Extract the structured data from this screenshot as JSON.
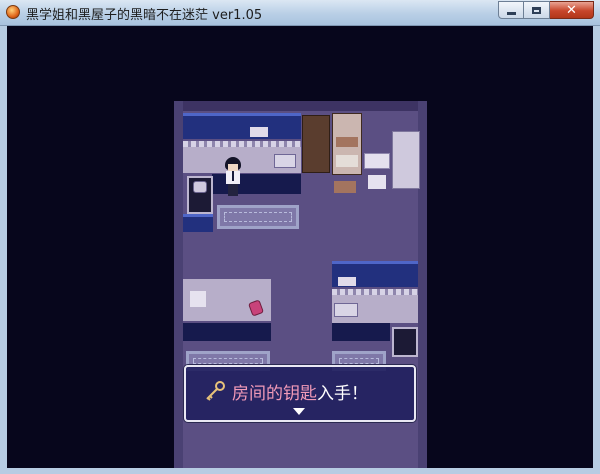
{
  "window": {
    "title": "黑学姐和黑屋子的黑暗不在迷茫 ver1.05",
    "buttons": [
      "minimize",
      "maximize",
      "close"
    ]
  },
  "dialog": {
    "item_name": "房间的钥匙",
    "suffix": "入手！",
    "icon": "key-icon",
    "continue_icon": "down-arrow-icon"
  },
  "colors": {
    "background": "#07061c",
    "dialog_bg": "#222160",
    "highlight": "#f29ab8"
  }
}
